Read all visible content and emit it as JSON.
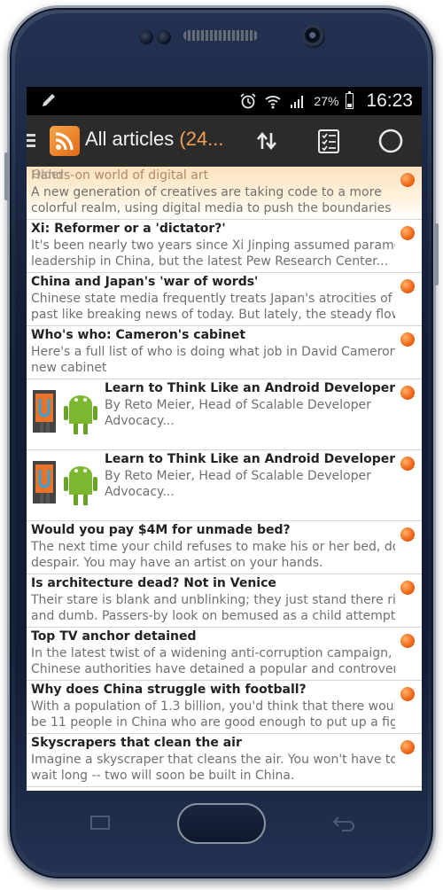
{
  "status_bar": {
    "battery": "27%",
    "battery_level": 0.27,
    "time": "16:23"
  },
  "action_bar": {
    "title": "All articles",
    "count": "(24..."
  },
  "older_label": "Older",
  "articles": [
    {
      "title": "Hands-on world of digital art",
      "description": "A new generation of creatives are taking code to a more",
      "description2": "colorful realm, using digital media to push the boundaries of..."
    },
    {
      "title": "Xi: Reformer or a 'dictator?'",
      "description": "It's been nearly two years since Xi Jinping assumed paramount",
      "description2": "leadership in China, but the latest Pew Research Center..."
    },
    {
      "title": "China and Japan's 'war of words'",
      "description": "Chinese state media frequently treats Japan's atrocities of the",
      "description2": "past like breaking news of today. But lately, the steady flow ..."
    },
    {
      "title": "Who's who: Cameron's cabinet",
      "description": "Here's a full list of who is doing what job in David Cameron's",
      "description2": "new cabinet"
    },
    {
      "title": "Learn to Think Like an Android Developer",
      "description": "By Reto Meier, Head of Scalable Developer",
      "description2": "Advocacy..."
    },
    {
      "title": "Learn to Think Like an Android Developer",
      "description": "By Reto Meier, Head of Scalable Developer",
      "description2": "Advocacy..."
    },
    {
      "title": "Would you pay $4M for unmade bed?",
      "description": "The next time your child refuses to make his or her bed, don't",
      "description2": "despair. You may have an artist on your hands."
    },
    {
      "title": "Is architecture dead? Not in Venice",
      "description": "Their stare is blank and unblinking; they just stand there rigid",
      "description2": "and dumb. Passers-by look on bemused as a child attempts t..."
    },
    {
      "title": "Top TV anchor detained",
      "description": "In the latest twist of a widening anti-corruption campaign,",
      "description2": "Chinese authorities have detained a popular and controversi..."
    },
    {
      "title": "Why does China struggle with football?",
      "description": "With a population of 1.3 billion, you'd think that there would",
      "description2": "be 11 people in China who are good enough to put up a fight..."
    },
    {
      "title": "Skyscrapers that clean the air",
      "description": "Imagine a skyscraper that cleans the air. You won't have to",
      "description2": "wait long -- two will soon be built in China."
    }
  ],
  "icons": {
    "edit": "pencil-icon",
    "alarm": "alarm-icon",
    "wifi": "wifi-icon",
    "signal": "signal-icon",
    "menu": "hamburger-icon",
    "app": "rss-icon",
    "sort": "sort-arrows-icon",
    "mark_read": "checklist-icon",
    "refresh": "circle-icon"
  },
  "colors": {
    "action_bar": "#2b2b2b",
    "accent": "#f0a052",
    "unread_dot": "#f26a1b"
  }
}
